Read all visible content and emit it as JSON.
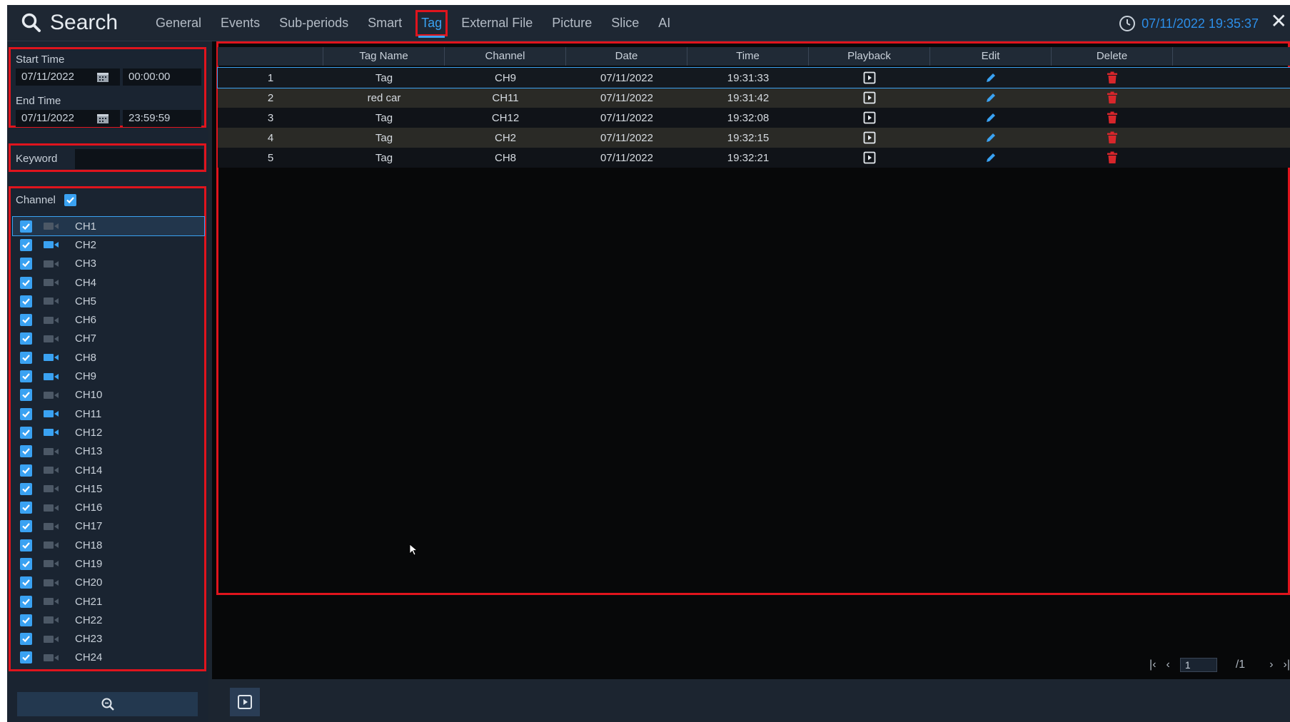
{
  "header": {
    "title": "Search",
    "tabs": [
      {
        "label": "General"
      },
      {
        "label": "Events"
      },
      {
        "label": "Sub-periods"
      },
      {
        "label": "Smart"
      },
      {
        "label": "Tag"
      },
      {
        "label": "External File"
      },
      {
        "label": "Picture"
      },
      {
        "label": "Slice"
      },
      {
        "label": "AI"
      }
    ],
    "active_tab": "Tag",
    "datetime": "07/11/2022 19:35:37",
    "close_icon": "close-icon"
  },
  "sidebar": {
    "start_time_label": "Start Time",
    "start_date": "07/11/2022",
    "start_time": "00:00:00",
    "end_time_label": "End Time",
    "end_date": "07/11/2022",
    "end_time": "23:59:59",
    "keyword_label": "Keyword",
    "keyword_value": "",
    "channel_label": "Channel",
    "channels": [
      {
        "name": "CH1",
        "checked": true,
        "recording": false
      },
      {
        "name": "CH2",
        "checked": true,
        "recording": true
      },
      {
        "name": "CH3",
        "checked": true,
        "recording": false
      },
      {
        "name": "CH4",
        "checked": true,
        "recording": false
      },
      {
        "name": "CH5",
        "checked": true,
        "recording": false
      },
      {
        "name": "CH6",
        "checked": true,
        "recording": false
      },
      {
        "name": "CH7",
        "checked": true,
        "recording": false
      },
      {
        "name": "CH8",
        "checked": true,
        "recording": true
      },
      {
        "name": "CH9",
        "checked": true,
        "recording": true
      },
      {
        "name": "CH10",
        "checked": true,
        "recording": false
      },
      {
        "name": "CH11",
        "checked": true,
        "recording": true
      },
      {
        "name": "CH12",
        "checked": true,
        "recording": true
      },
      {
        "name": "CH13",
        "checked": true,
        "recording": false
      },
      {
        "name": "CH14",
        "checked": true,
        "recording": false
      },
      {
        "name": "CH15",
        "checked": true,
        "recording": false
      },
      {
        "name": "CH16",
        "checked": true,
        "recording": false
      },
      {
        "name": "CH17",
        "checked": true,
        "recording": false
      },
      {
        "name": "CH18",
        "checked": true,
        "recording": false
      },
      {
        "name": "CH19",
        "checked": true,
        "recording": false
      },
      {
        "name": "CH20",
        "checked": true,
        "recording": false
      },
      {
        "name": "CH21",
        "checked": true,
        "recording": false
      },
      {
        "name": "CH22",
        "checked": true,
        "recording": false
      },
      {
        "name": "CH23",
        "checked": true,
        "recording": false
      },
      {
        "name": "CH24",
        "checked": true,
        "recording": false
      }
    ],
    "selected_channel": "CH1",
    "search_icon": "search-icon"
  },
  "table": {
    "columns": [
      "",
      "Tag Name",
      "Channel",
      "Date",
      "Time",
      "Playback",
      "Edit",
      "Delete",
      ""
    ],
    "rows": [
      {
        "index": "1",
        "tag_name": "Tag",
        "channel": "CH9",
        "date": "07/11/2022",
        "time": "19:31:33"
      },
      {
        "index": "2",
        "tag_name": "red car",
        "channel": "CH11",
        "date": "07/11/2022",
        "time": "19:31:42"
      },
      {
        "index": "3",
        "tag_name": "Tag",
        "channel": "CH12",
        "date": "07/11/2022",
        "time": "19:32:08"
      },
      {
        "index": "4",
        "tag_name": "Tag",
        "channel": "CH2",
        "date": "07/11/2022",
        "time": "19:32:15"
      },
      {
        "index": "5",
        "tag_name": "Tag",
        "channel": "CH8",
        "date": "07/11/2022",
        "time": "19:32:21"
      }
    ],
    "playback_icon": "play-icon",
    "edit_icon": "pencil-icon",
    "delete_icon": "trash-icon"
  },
  "pager": {
    "current_page": "1",
    "total_pages": "/1"
  },
  "colors": {
    "accent": "#3aa2f2",
    "highlight_box": "#e0141d",
    "delete": "#d8262b"
  }
}
